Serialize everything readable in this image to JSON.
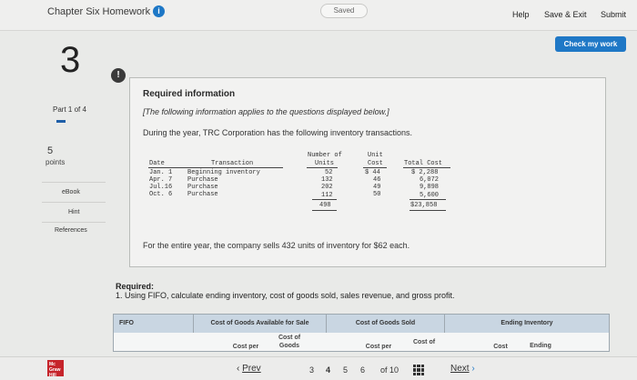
{
  "header": {
    "assignment_title": "Chapter Six Homework",
    "info_icon_glyph": "i",
    "status": "Saved",
    "help": "Help",
    "save_exit": "Save & Exit",
    "submit": "Submit",
    "check_my_work": "Check my work"
  },
  "question": {
    "number": "3",
    "alert_glyph": "!",
    "part_label": "Part 1 of 4",
    "points_value": "5",
    "points_label": "points"
  },
  "sidebar": {
    "ebook": "eBook",
    "hint": "Hint",
    "references": "References"
  },
  "info_panel": {
    "title": "Required information",
    "italic_note": "[The following information applies to the questions displayed below.]",
    "intro": "During the year, TRC Corporation has the following inventory transactions.",
    "headers": {
      "date": "Date",
      "transaction": "Transaction",
      "units_line1": "Number of",
      "units_line2": "Units",
      "cost_line1": "Unit",
      "cost_line2": "Cost",
      "total_cost": "Total Cost"
    },
    "rows": [
      {
        "date": "Jan. 1",
        "transaction": "Beginning inventory",
        "units": "52",
        "cost": "$ 44",
        "total": "$ 2,288"
      },
      {
        "date": "Apr. 7",
        "transaction": "Purchase",
        "units": "132",
        "cost": "46",
        "total": "6,072"
      },
      {
        "date": "Jul.16",
        "transaction": "Purchase",
        "units": "202",
        "cost": "49",
        "total": "9,898"
      },
      {
        "date": "Oct. 6",
        "transaction": "Purchase",
        "units": "112",
        "cost": "50",
        "total": "5,600"
      }
    ],
    "totals": {
      "units": "498",
      "total": "$23,858"
    },
    "sales_text": "For the entire year, the company sells 432 units of inventory for $62 each."
  },
  "required": {
    "heading": "Required:",
    "item": "1. Using FIFO, calculate ending inventory, cost of goods sold, sales revenue, and gross profit."
  },
  "answer_table": {
    "method": "FIFO",
    "col_available": "Cost of Goods Available for Sale",
    "col_sold": "Cost of Goods Sold",
    "col_ending": "Ending Inventory",
    "sub_cost_per": "Cost per",
    "sub_cost_of_line1": "Cost of",
    "sub_cost_of_line2": "Goods",
    "sub_cost_per_2": "Cost per",
    "sub_cost_of_sold": "Cost of",
    "sub_cost_per_3": "Cost",
    "sub_ending": "Ending"
  },
  "footer": {
    "logo_line1": "Mc",
    "logo_line2": "Graw",
    "logo_line3": "Hill",
    "prev": "Prev",
    "pages": [
      "3",
      "4",
      "5",
      "6"
    ],
    "of_total": "of 10",
    "next": "Next"
  },
  "colors": {
    "accent_blue": "#1f78c6",
    "table_header": "#c9d6e2",
    "logo_red": "#c6242b"
  }
}
